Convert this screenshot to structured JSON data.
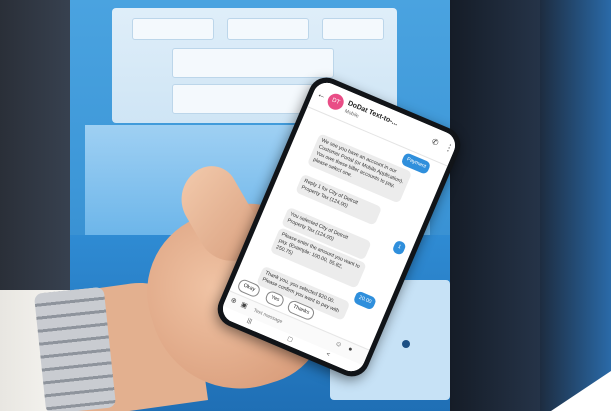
{
  "chat": {
    "avatar_initials": "DT",
    "contact_name": "DoDat Text-to-...",
    "contact_sub": "Mobile",
    "messages": [
      {
        "dir": "out",
        "text": "Payment"
      },
      {
        "dir": "in",
        "text": "We see you have an account in our Customer Portal (or Mobile Application). You owe these biller accounts to pay, please select one."
      },
      {
        "dir": "in",
        "text": "Reply 1 for City of Detroit Property Tax (124.00)"
      },
      {
        "dir": "out",
        "text": "1"
      },
      {
        "dir": "in",
        "text": "You selected City of Detroit Property Tax (124.00)"
      },
      {
        "dir": "in",
        "text": "Please enter the amount you want to pay. (Example: 100.00, 55.82, 250.75)"
      },
      {
        "dir": "out",
        "text": "20.00"
      },
      {
        "dir": "in",
        "text": "Thank you, you selected $20.00. Please confirm you want to pay with"
      }
    ],
    "quick_replies": [
      "Okay",
      "Yes",
      "Thanks"
    ],
    "input_placeholder": "Text message"
  },
  "colors": {
    "kiosk_blue": "#3d97d8",
    "outgoing_bubble": "#2f8fdc",
    "avatar_pink": "#e94d86"
  },
  "icons": [
    "back-arrow-icon",
    "phone-call-icon",
    "more-options-icon",
    "add-icon",
    "gallery-icon",
    "emoji-icon",
    "microphone-icon",
    "nav-recent-icon",
    "nav-home-icon",
    "nav-back-icon"
  ]
}
